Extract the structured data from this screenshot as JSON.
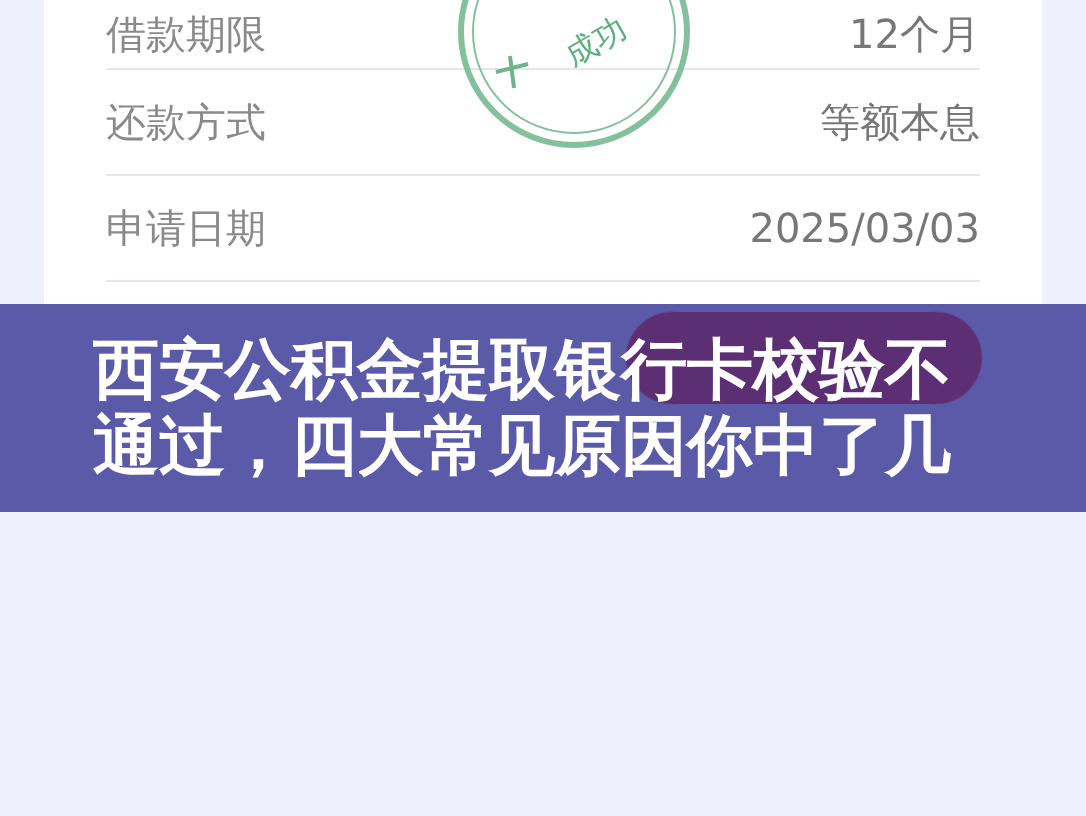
{
  "details": [
    {
      "label": "借款期限",
      "value": "12个月"
    },
    {
      "label": "还款方式",
      "value": "等额本息"
    },
    {
      "label": "申请日期",
      "value": "2025/03/03"
    }
  ],
  "stamp": {
    "lines": [
      "成功"
    ]
  },
  "banner": {
    "title": "西安公积金提取银行卡校验不通过，四大常见原因你中了几"
  }
}
